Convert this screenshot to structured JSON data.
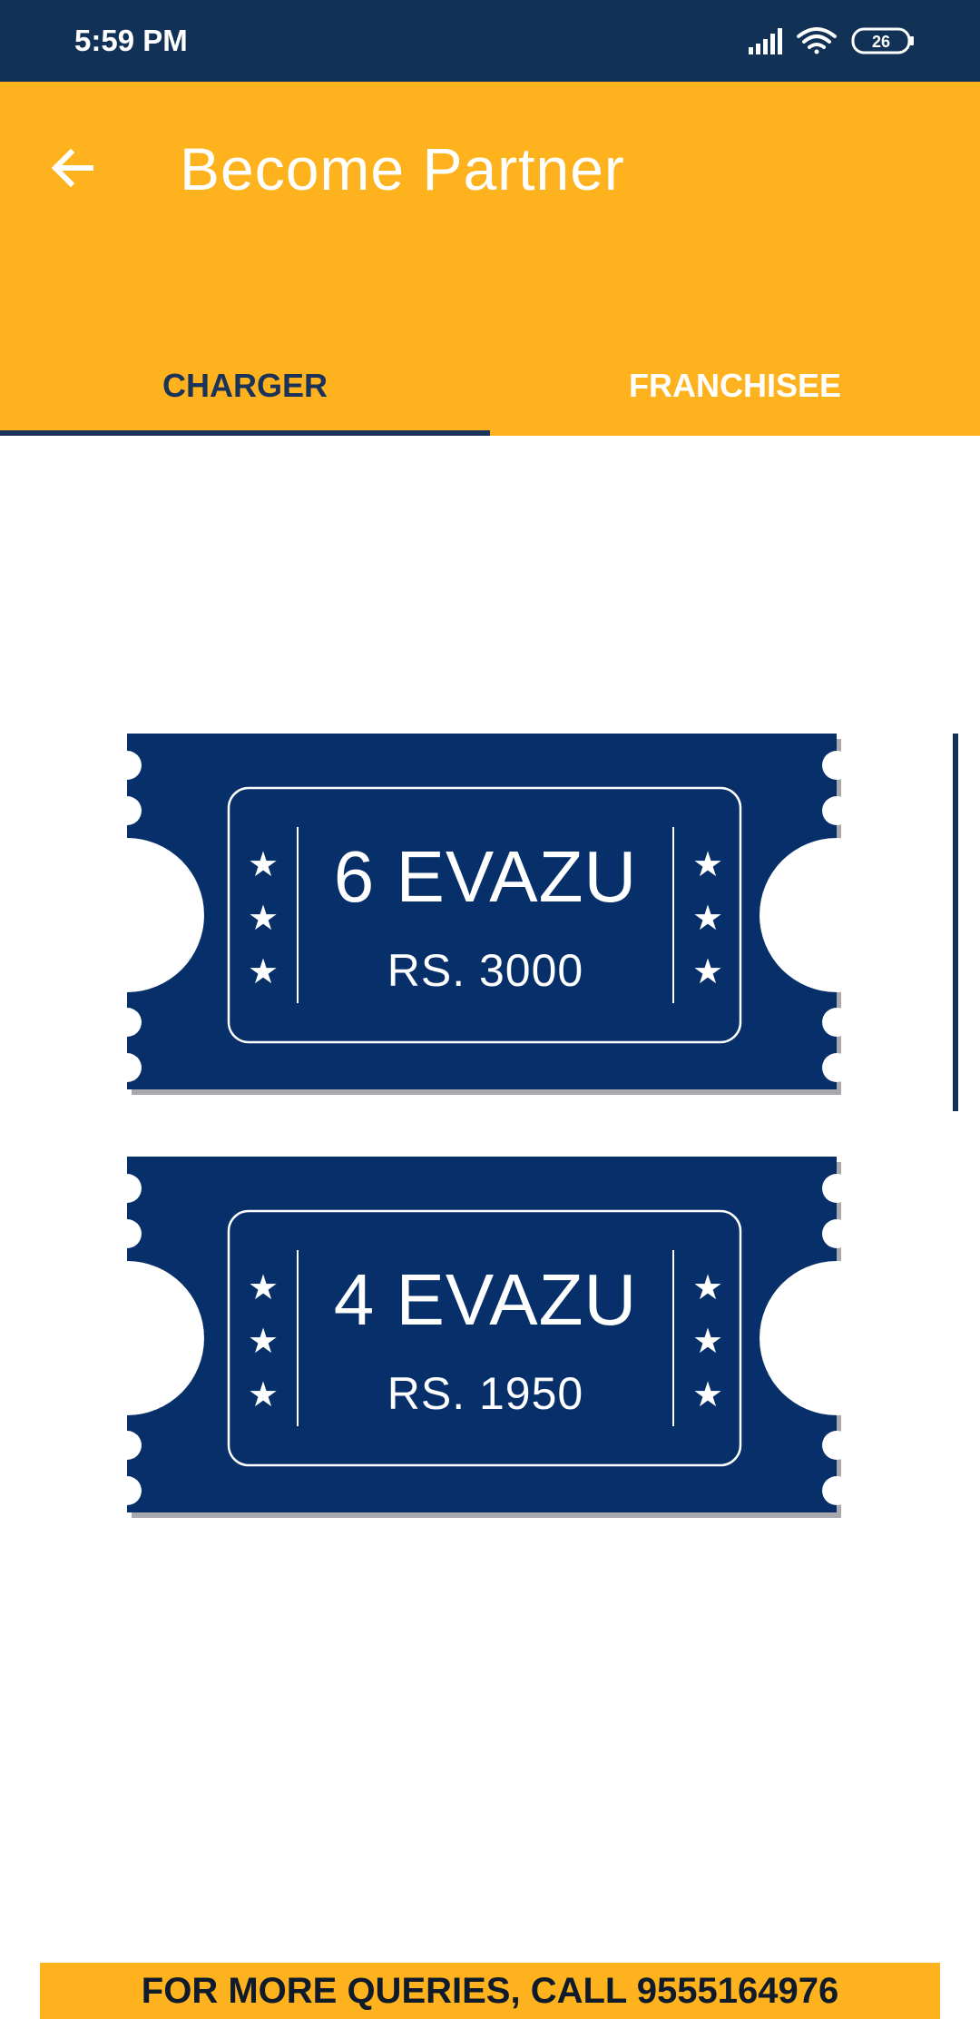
{
  "status_bar": {
    "time": "5:59 PM",
    "battery": "26",
    "icons": [
      "signal-icon",
      "wifi-icon",
      "battery-icon"
    ]
  },
  "app_bar": {
    "title": "Become Partner",
    "back_icon": "arrow-left-icon"
  },
  "tabs": [
    {
      "label": "CHARGER",
      "selected": true
    },
    {
      "label": "FRANCHISEE",
      "selected": false
    }
  ],
  "tickets": [
    {
      "name": "6 EVAZU",
      "price": "RS. 3000"
    },
    {
      "name": "4 EVAZU",
      "price": "RS. 1950"
    }
  ],
  "footer": {
    "text": "FOR MORE QUERIES, CALL 9555164976"
  },
  "colors": {
    "status_bar": "#123156",
    "accent": "#fdb21e",
    "ticket": "#07306a",
    "tab_active": "#1b3358"
  }
}
